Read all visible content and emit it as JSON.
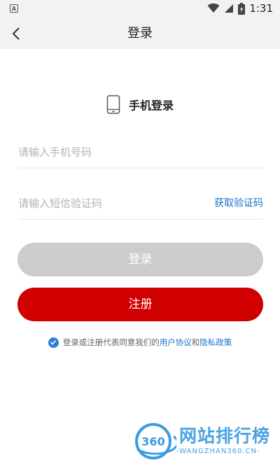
{
  "status_bar": {
    "time": "1:31",
    "notification_icon": "A"
  },
  "header": {
    "title": "登录"
  },
  "login_type": {
    "label": "手机登录"
  },
  "phone_field": {
    "placeholder": "请输入手机号码"
  },
  "code_field": {
    "placeholder": "请输入短信验证码",
    "get_code_label": "获取验证码"
  },
  "buttons": {
    "login_label": "登录",
    "register_label": "注册"
  },
  "agreement": {
    "prefix": "登录或注册代表同意我们的",
    "user_agreement": "用户协议",
    "conjunction": "和",
    "privacy_policy": "隐私政策",
    "checked": true
  },
  "watermark": {
    "logo_number": "360",
    "title": "网站排行榜",
    "subtitle": "-WANGZHAN360.CN-"
  },
  "colors": {
    "accent": "#d10000",
    "link": "#1a73c8",
    "disabled": "#cccccc",
    "check": "#2f7fd8"
  }
}
